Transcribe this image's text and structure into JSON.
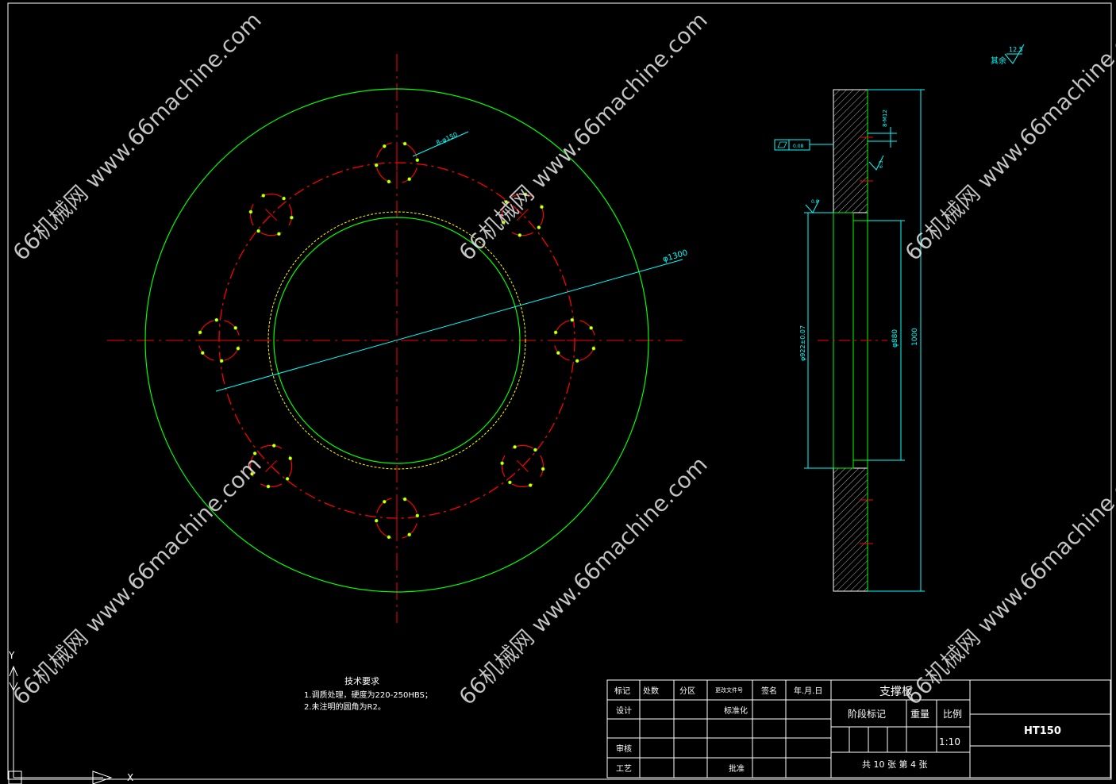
{
  "colors": {
    "background": "#000000",
    "frame": "#ffffff",
    "outline_green": "#00ff00",
    "centerline_red": "#ff0000",
    "dimension_cyan": "#00ffff",
    "bore_yellow": "#ffff00",
    "hatch": "#ffffff"
  },
  "dimensions": {
    "outer_diameter": "φ1300",
    "holes": "8-φ150",
    "bore_diameter": "φ922±0.07",
    "inner_diameter": "φ880",
    "height": "1000",
    "bolt_holes": "8-M12",
    "flatness_tol": "0.08",
    "roughness_face": "6.3",
    "roughness_bore": "0.8",
    "roughness_rest_value": "12.5",
    "roughness_rest_label": "其余"
  },
  "notes": {
    "title": "技术要求",
    "line1": "1.调质处理，硬度为220-250HBS；",
    "line2": "2.未注明的圆角为R2。"
  },
  "title_block": {
    "h_mark": "标记",
    "h_count": "处数",
    "h_zone": "分区",
    "h_docno": "更改文件号",
    "h_sign": "签名",
    "h_date": "年.月.日",
    "design": "设计",
    "standard": "标准化",
    "review": "审核",
    "process": "工艺",
    "approve": "批准",
    "part_name": "支撑板",
    "stage_mark": "阶段标记",
    "weight": "重量",
    "scale_label": "比例",
    "scale": "1:10",
    "sheets": "共 10 张  第 4 张",
    "material": "HT150"
  },
  "watermark": "66机械网 www.66machine.com"
}
